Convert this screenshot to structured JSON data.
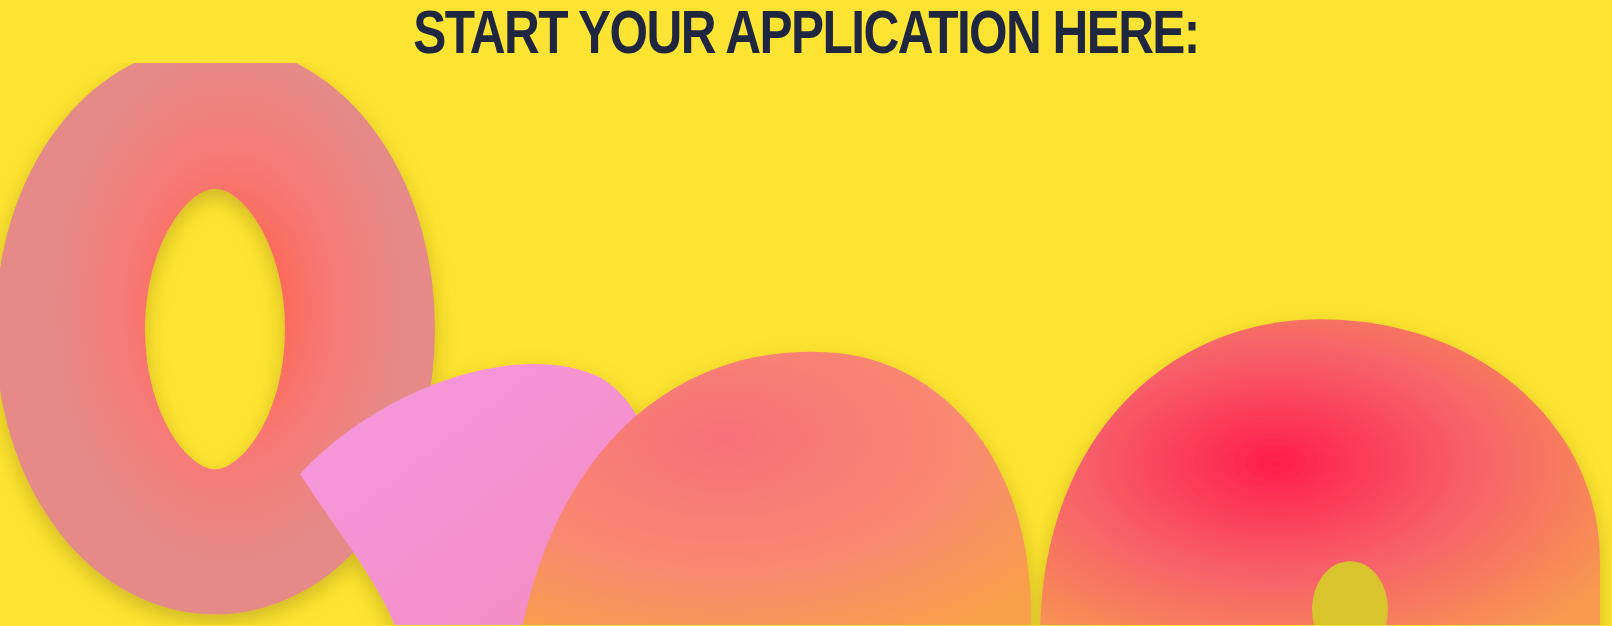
{
  "heading": {
    "text": "START YOUR APPLICATION HERE:"
  }
}
